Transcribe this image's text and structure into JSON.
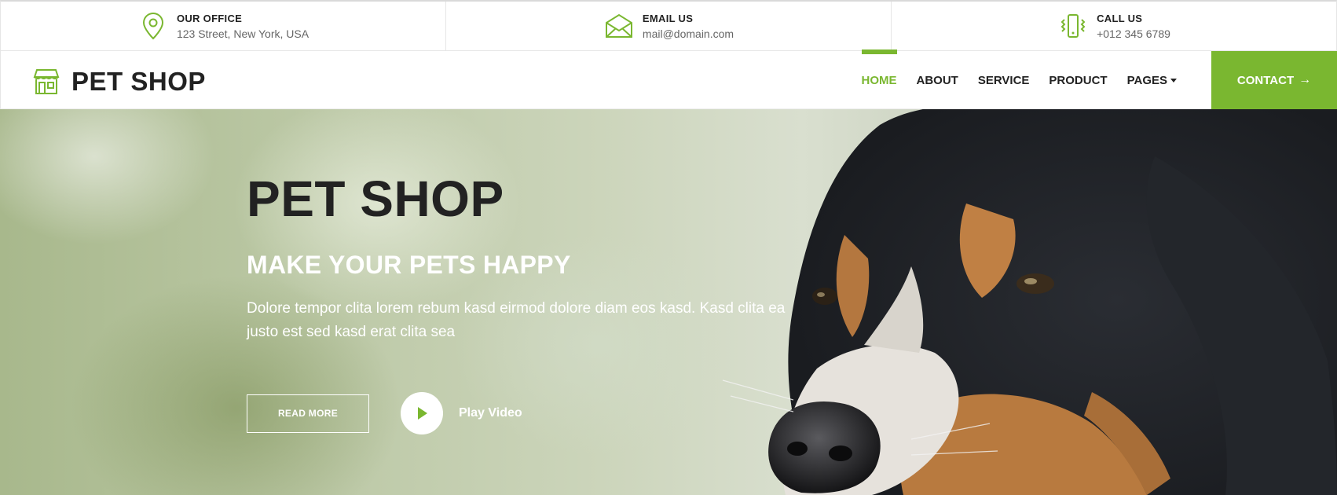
{
  "topbar": {
    "office": {
      "title": "OUR OFFICE",
      "value": "123 Street, New York, USA",
      "icon": "map-marker-icon"
    },
    "email": {
      "title": "EMAIL US",
      "value": "mail@domain.com",
      "icon": "envelope-icon"
    },
    "call": {
      "title": "CALL US",
      "value": "+012 345 6789",
      "icon": "phone-vibrate-icon"
    }
  },
  "navbar": {
    "brand": "PET SHOP",
    "brand_icon": "shop-icon",
    "links": [
      {
        "label": "HOME",
        "active": true
      },
      {
        "label": "ABOUT"
      },
      {
        "label": "SERVICE"
      },
      {
        "label": "PRODUCT"
      },
      {
        "label": "PAGES",
        "dropdown": true
      }
    ],
    "contact": {
      "label": "CONTACT",
      "icon": "arrow-right-icon"
    }
  },
  "hero": {
    "title": "PET SHOP",
    "subtitle": "MAKE YOUR PETS HAPPY",
    "text": "Dolore tempor clita lorem rebum kasd eirmod dolore diam eos kasd. Kasd clita ea justo est sed kasd erat clita sea",
    "read_more": "READ MORE",
    "play_label": "Play Video",
    "play_icon": "play-icon"
  },
  "colors": {
    "accent": "#7ab730",
    "dark": "#222222"
  }
}
